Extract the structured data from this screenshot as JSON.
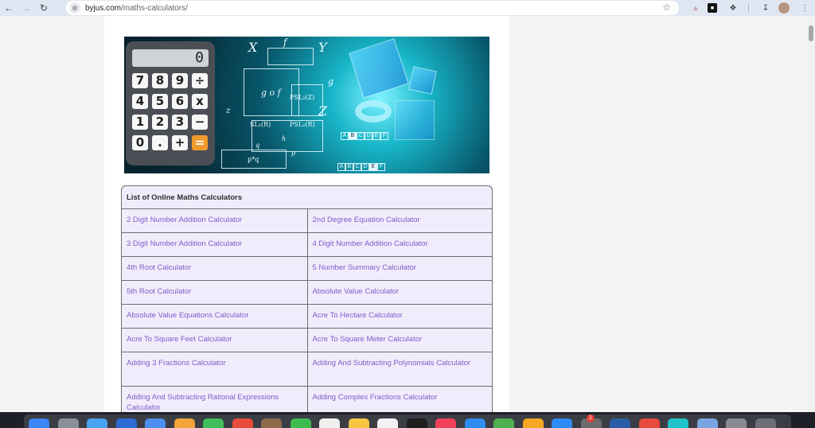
{
  "browser": {
    "url_host": "byjus.com",
    "url_path": "/maths-calculators/",
    "icons": [
      "back-icon",
      "forward-icon",
      "reload-icon",
      "site-info-icon",
      "bookmark-star-icon",
      "extension-icon",
      "download-icon",
      "profile-avatar",
      "menu-icon"
    ]
  },
  "banner": {
    "calculator": {
      "display": "0",
      "keys": [
        "7",
        "8",
        "9",
        "÷",
        "4",
        "5",
        "6",
        "x",
        "1",
        "2",
        "3",
        "−",
        "0",
        ".",
        "+",
        "="
      ]
    },
    "formulas": [
      "X",
      "f",
      "Y",
      "g o f",
      "PSL₂(Z)",
      "SL₂(R)",
      "PSL₂(R)",
      "Z",
      "z",
      "h",
      "g",
      "p*q",
      "q",
      "p"
    ],
    "letter_strip_top": [
      "A",
      "B",
      "C",
      "D",
      "E",
      "F"
    ],
    "letter_strip_bottom": [
      "A",
      "B",
      "C",
      "D",
      "E",
      "F"
    ]
  },
  "table": {
    "heading": "List of Online Maths Calculators",
    "rows": [
      [
        "2 Digit Number Addition Calculator",
        "2nd Degree Equation Calculator"
      ],
      [
        "3 Digit Number Addition Calculator",
        "4 Digit Number Addition Calculator"
      ],
      [
        "4th Root Calculator",
        "5 Number Summary Calculator"
      ],
      [
        "5th Root Calculator",
        "Absolute Value Calculator"
      ],
      [
        "Absolute Value Equations Calculator",
        "Acre To Hectare Calculator"
      ],
      [
        "Acre To Square Feet Calculator",
        "Acre To Square Meter Calculator"
      ],
      [
        "Adding 3 Fractions Calculator",
        "Adding And Subtracting Polynomials Calculator"
      ],
      [
        "Adding And Subtracting Rational Expressions Calculator",
        "Adding Complex Fractions Calculator"
      ]
    ]
  },
  "dock": {
    "badge_count": "1",
    "colors": [
      "#3d86f4",
      "#8b8f97",
      "#4aa3f0",
      "#2c6bd6",
      "#4d8ff0",
      "#f2a33a",
      "#3fbf5a",
      "#e84b3c",
      "#8c6b4a",
      "#3dbb4f",
      "#f0f0f0",
      "#f6c643",
      "#f2f2f2",
      "#1f1f1f",
      "#f04158",
      "#2d8cf0",
      "#4fb04f",
      "#f5a623",
      "#2e8bf5",
      "#6b6b6b",
      "#2a5fa8",
      "#e64a3c",
      "#21c3c9",
      "#7aa5e3",
      "#888c92",
      "#6c6f75"
    ]
  }
}
